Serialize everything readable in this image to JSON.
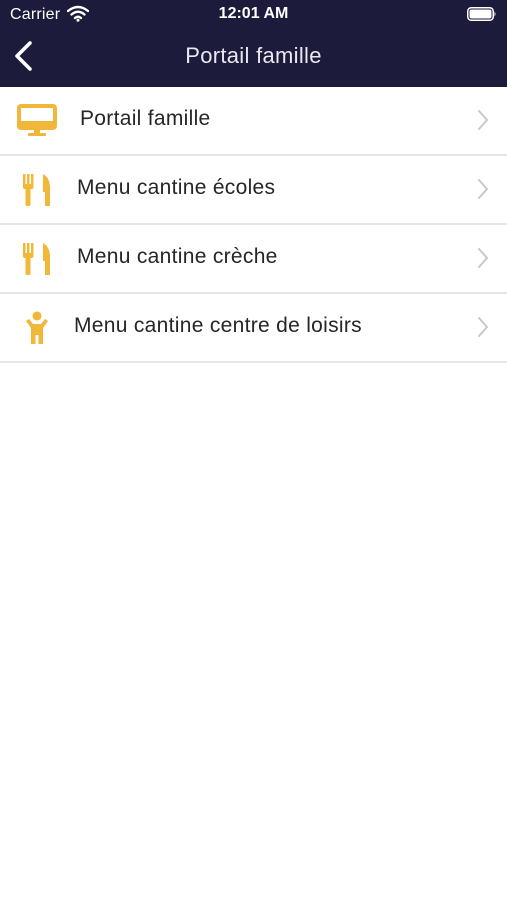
{
  "colors": {
    "header_bg": "#1c1b3b",
    "icon_accent": "#f0b738",
    "chevron": "#c8c8cc",
    "divider": "#e6e6e6"
  },
  "status_bar": {
    "carrier": "Carrier",
    "time": "12:01 AM"
  },
  "nav": {
    "title": "Portail famille",
    "back_icon": "chevron-left-icon"
  },
  "menu": {
    "items": [
      {
        "label": "Portail famille",
        "icon": "monitor-icon"
      },
      {
        "label": "Menu cantine écoles",
        "icon": "cutlery-icon"
      },
      {
        "label": "Menu cantine crèche",
        "icon": "cutlery-icon"
      },
      {
        "label": "Menu cantine centre de loisirs",
        "icon": "child-icon"
      }
    ]
  }
}
